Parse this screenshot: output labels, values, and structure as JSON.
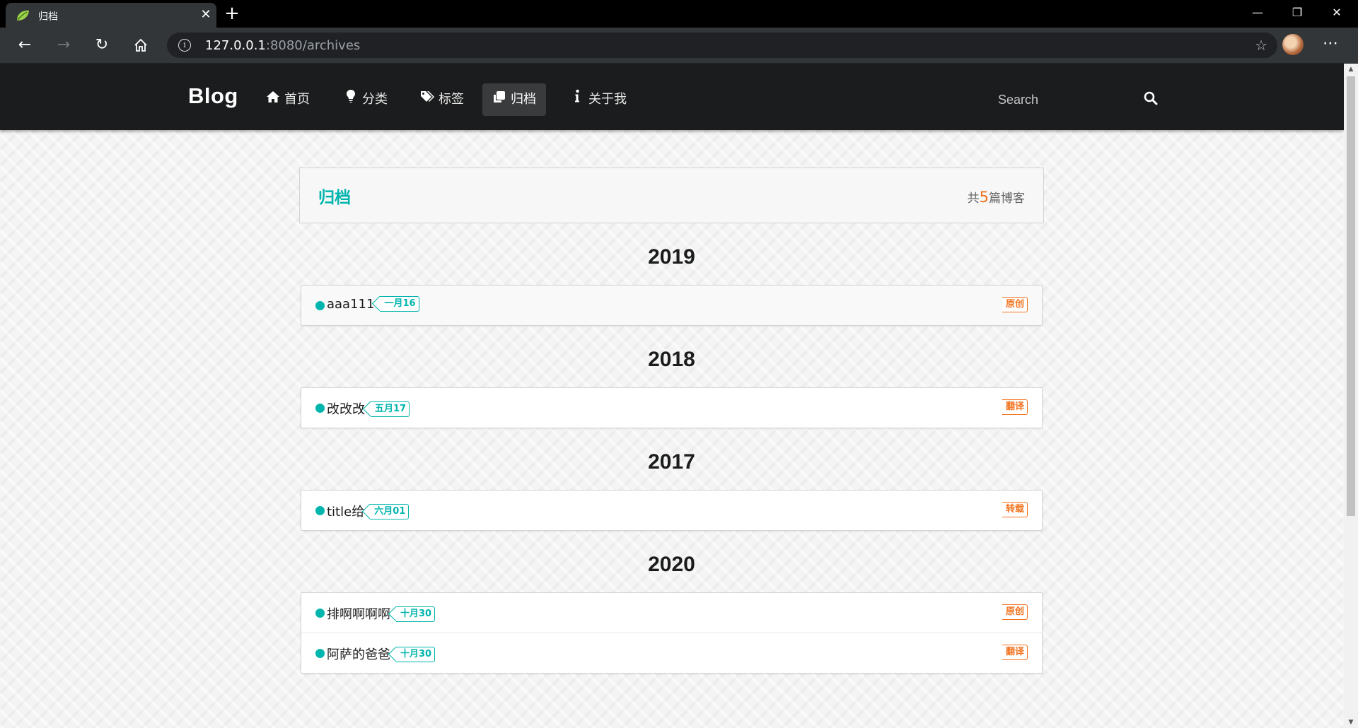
{
  "browser": {
    "tab_title": "归档",
    "url_host": "127.0.0.1",
    "url_rest": ":8080/archives"
  },
  "nav": {
    "brand": "Blog",
    "items": [
      {
        "label": "首页",
        "icon": "home-icon"
      },
      {
        "label": "分类",
        "icon": "lightbulb-icon"
      },
      {
        "label": "标签",
        "icon": "tags-icon"
      },
      {
        "label": "归档",
        "icon": "clone-icon",
        "active": true
      },
      {
        "label": "关于我",
        "icon": "info-icon"
      }
    ],
    "search_placeholder": "Search"
  },
  "archive": {
    "title": "归档",
    "count_prefix": "共",
    "count": "5",
    "count_suffix": "篇博客"
  },
  "years": [
    {
      "year": "2019",
      "posts": [
        {
          "title": "aaa111",
          "date": "一月16",
          "type": "原创"
        }
      ]
    },
    {
      "year": "2018",
      "posts": [
        {
          "title": "改改改",
          "date": "五月17",
          "type": "翻译"
        }
      ]
    },
    {
      "year": "2017",
      "posts": [
        {
          "title": "title给",
          "date": "六月01",
          "type": "转载"
        }
      ]
    },
    {
      "year": "2020",
      "posts": [
        {
          "title": "排啊啊啊啊",
          "date": "十月30",
          "type": "原创"
        },
        {
          "title": "阿萨的爸爸",
          "date": "十月30",
          "type": "翻译"
        }
      ]
    }
  ],
  "colors": {
    "teal": "#00b5ad",
    "orange": "#f2711c",
    "nav_bg": "#1b1c1d"
  }
}
